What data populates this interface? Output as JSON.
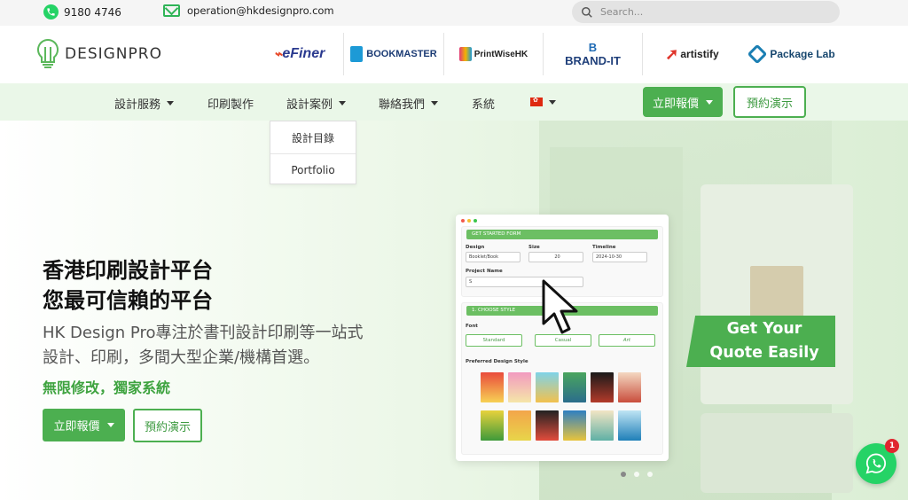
{
  "topbar": {
    "phone": "9180 4746",
    "email": "operation@hkdesignpro.com",
    "search_placeholder": "Search..."
  },
  "brand": {
    "logo_text": "DESIGNPRO"
  },
  "partners": [
    {
      "name": "eFiner",
      "color": "#2a3a8f"
    },
    {
      "name": "BOOKMASTER",
      "color": "#1b3b74"
    },
    {
      "name": "PrintWiseHK",
      "color": "#222222"
    },
    {
      "name": "BRAND-IT",
      "color": "#1f3f7a"
    },
    {
      "name": "artistify",
      "color": "#222222"
    },
    {
      "name": "Package Lab",
      "color": "#16466e"
    }
  ],
  "nav": {
    "items": [
      {
        "label": "設計服務",
        "has_caret": true
      },
      {
        "label": "印刷製作",
        "has_caret": false
      },
      {
        "label": "設計案例",
        "has_caret": true
      },
      {
        "label": "聯絡我們",
        "has_caret": true
      },
      {
        "label": "系統",
        "has_caret": false
      }
    ],
    "quote_button": "立即報價",
    "demo_button": "預約演示",
    "dropdown": [
      "設計目錄",
      "Portfolio"
    ]
  },
  "hero": {
    "title_line1": "香港印刷設計平台",
    "title_line2": "您最可信賴的平台",
    "subtitle": "HK Design Pro專注於書刊設計印刷等一站式設計、印刷，多間大型企業/機構首選。",
    "highlight": "無限修改，獨家系統",
    "quote_button": "立即報價",
    "demo_button": "預約演示",
    "get_quote_line1": "Get Your",
    "get_quote_line2": "Quote Easily"
  },
  "form_mock": {
    "header": "GET STARTED FORM",
    "design_label": "Design",
    "design_value": "Booklet/Book",
    "size_label": "Size",
    "size_value": "20",
    "timeline_label": "Timeline",
    "timeline_value": "2024-10-30",
    "project_label": "Project Name",
    "project_value": "S",
    "style_header": "1. CHOOSE STYLE",
    "font_label": "Font",
    "font_options": [
      "Standard",
      "Casual",
      "Art"
    ],
    "preferred_label": "Preferred Design Style"
  },
  "whatsapp": {
    "badge": "1"
  },
  "colors": {
    "accent": "#4caf50",
    "nav_bg": "#eaf7e8",
    "whatsapp": "#25d366"
  }
}
